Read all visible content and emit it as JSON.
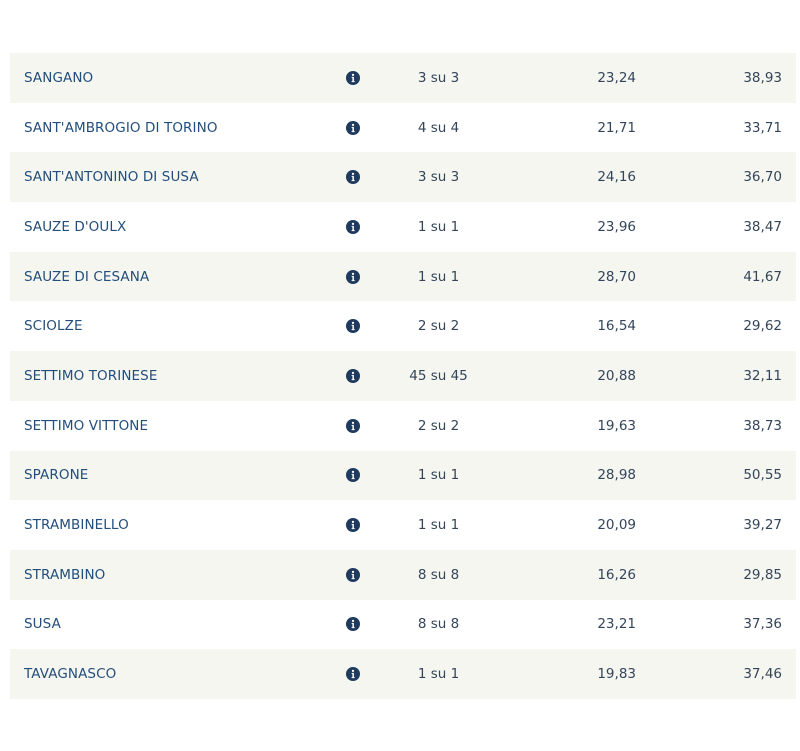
{
  "colors": {
    "row_shaded": "#f5f6f0",
    "text": "#234e7c",
    "icon": "#1e3a5f"
  },
  "rows": [
    {
      "name": "SANGANO",
      "sections": "3 su 3",
      "value1": "23,24",
      "value2": "38,93",
      "icon": "info-icon"
    },
    {
      "name": "SANT'AMBROGIO DI TORINO",
      "sections": "4 su 4",
      "value1": "21,71",
      "value2": "33,71",
      "icon": "info-icon"
    },
    {
      "name": "SANT'ANTONINO DI SUSA",
      "sections": "3 su 3",
      "value1": "24,16",
      "value2": "36,70",
      "icon": "info-icon"
    },
    {
      "name": "SAUZE D'OULX",
      "sections": "1 su 1",
      "value1": "23,96",
      "value2": "38,47",
      "icon": "info-icon"
    },
    {
      "name": "SAUZE DI CESANA",
      "sections": "1 su 1",
      "value1": "28,70",
      "value2": "41,67",
      "icon": "info-icon"
    },
    {
      "name": "SCIOLZE",
      "sections": "2 su 2",
      "value1": "16,54",
      "value2": "29,62",
      "icon": "info-icon"
    },
    {
      "name": "SETTIMO TORINESE",
      "sections": "45 su 45",
      "value1": "20,88",
      "value2": "32,11",
      "icon": "info-icon"
    },
    {
      "name": "SETTIMO VITTONE",
      "sections": "2 su 2",
      "value1": "19,63",
      "value2": "38,73",
      "icon": "info-icon"
    },
    {
      "name": "SPARONE",
      "sections": "1 su 1",
      "value1": "28,98",
      "value2": "50,55",
      "icon": "info-icon"
    },
    {
      "name": "STRAMBINELLO",
      "sections": "1 su 1",
      "value1": "20,09",
      "value2": "39,27",
      "icon": "info-icon"
    },
    {
      "name": "STRAMBINO",
      "sections": "8 su 8",
      "value1": "16,26",
      "value2": "29,85",
      "icon": "info-icon"
    },
    {
      "name": "SUSA",
      "sections": "8 su 8",
      "value1": "23,21",
      "value2": "37,36",
      "icon": "info-icon"
    },
    {
      "name": "TAVAGNASCO",
      "sections": "1 su 1",
      "value1": "19,83",
      "value2": "37,46",
      "icon": "info-icon"
    }
  ]
}
